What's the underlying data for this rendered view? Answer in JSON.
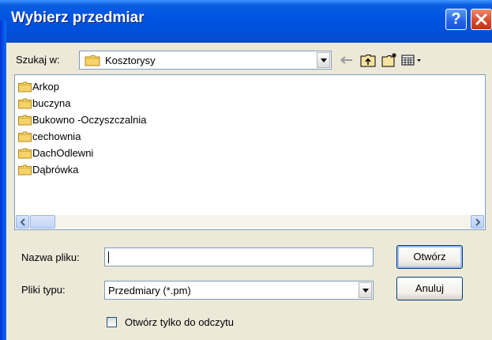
{
  "window": {
    "title": "Wybierz przedmiar"
  },
  "titlebar_buttons": {
    "help": "?",
    "close": "close-icon"
  },
  "lookin": {
    "label": "Szukaj w:",
    "value": "Kosztorysy"
  },
  "toolbar": {
    "back": "back-arrow-icon",
    "up": "up-folder-icon",
    "new_folder": "new-folder-icon",
    "views": "views-menu-icon"
  },
  "files": [
    {
      "name": "Arkop"
    },
    {
      "name": "buczyna"
    },
    {
      "name": "Bukowno -Oczyszczalnia"
    },
    {
      "name": "cechownia"
    },
    {
      "name": "DachOdlewni"
    },
    {
      "name": "Dąbrówka"
    }
  ],
  "filename": {
    "label": "Nazwa pliku:",
    "value": ""
  },
  "filetype": {
    "label": "Pliki typu:",
    "value": "Przedmiary (*.pm)"
  },
  "buttons": {
    "open": "Otwórz",
    "cancel": "Anuluj"
  },
  "readonly": {
    "label": "Otwórz tylko do odczytu",
    "checked": false
  },
  "colors": {
    "titlebar": "#0054e3",
    "face": "#ece9d8",
    "folder": "#f5d36b"
  }
}
